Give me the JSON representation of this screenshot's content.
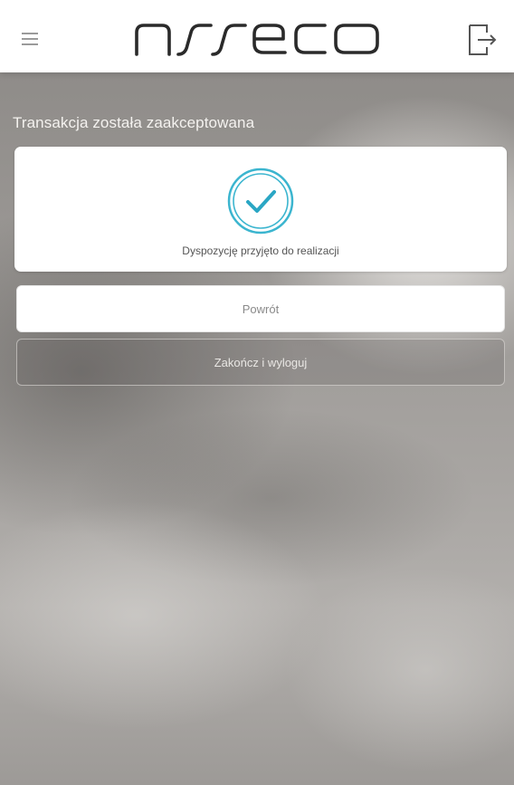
{
  "header": {
    "logo_text": "asseco",
    "menu_icon": "hamburger-menu-icon",
    "logout_icon": "logout-arrow-icon"
  },
  "main": {
    "title": "Transakcja została zaakceptowana",
    "confirmation": {
      "icon": "checkmark-circle-icon",
      "message": "Dyspozycję przyjęto do realizacji"
    },
    "buttons": {
      "back_label": "Powrót",
      "end_logout_label": "Zakończ i wyloguj"
    }
  },
  "colors": {
    "accent_teal": "#3bb5cf",
    "card_background": "#ffffff",
    "header_background": "#ffffff"
  }
}
